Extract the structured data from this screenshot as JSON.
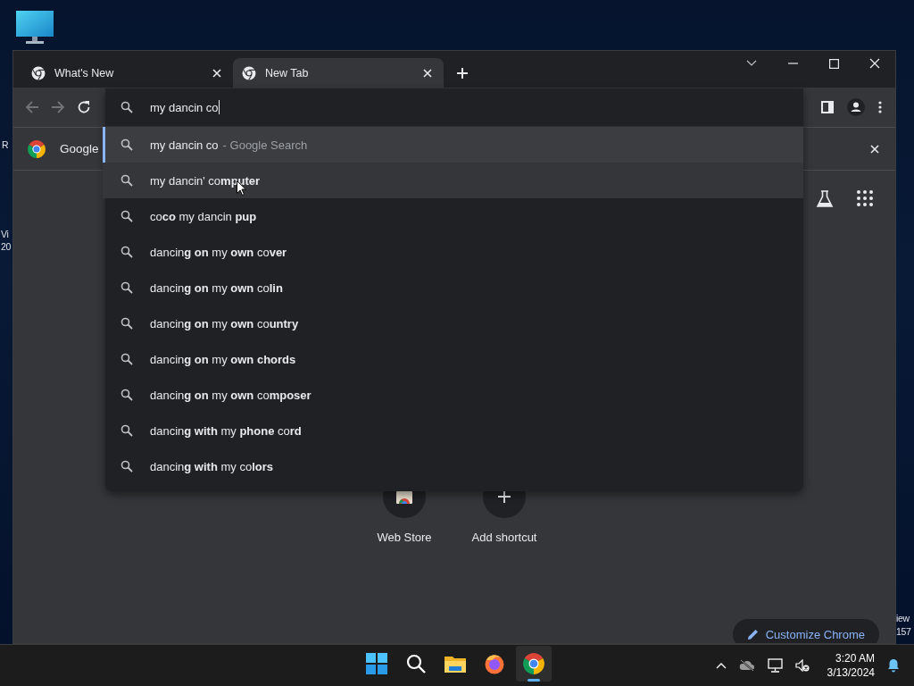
{
  "desktop": {
    "background_texts": [
      "R",
      "Vi",
      "20",
      "iew",
      "157"
    ]
  },
  "browser": {
    "tabs": [
      {
        "title": "What's New",
        "selected": false
      },
      {
        "title": "New Tab",
        "selected": true
      }
    ],
    "omnibox": {
      "value": "my dancin co"
    },
    "suggestions": [
      {
        "text": "my dancin co",
        "description": "- Google Search",
        "selected": true,
        "hovered": false
      },
      {
        "text": "my dancin' co**mputer**",
        "selected": false,
        "hovered": true
      },
      {
        "text": "co**co** my dancin **pup**",
        "selected": false,
        "hovered": false
      },
      {
        "text": "dancin**g on** my **own** co**ver**",
        "selected": false,
        "hovered": false
      },
      {
        "text": "dancin**g on** my **own** co**lin**",
        "selected": false,
        "hovered": false
      },
      {
        "text": "dancin**g on** my **own** co**untry**",
        "selected": false,
        "hovered": false
      },
      {
        "text": "dancin**g on** my **own chords**",
        "selected": false,
        "hovered": false
      },
      {
        "text": "dancin**g on** my **own** co**mposer**",
        "selected": false,
        "hovered": false
      },
      {
        "text": "dancin**g with** my **phone** co**rd**",
        "selected": false,
        "hovered": false
      },
      {
        "text": "dancin**g with** my co**lors**",
        "selected": false,
        "hovered": false
      }
    ],
    "info_bar": {
      "text": "Google"
    },
    "shortcuts": [
      {
        "label": "Web Store",
        "kind": "store"
      },
      {
        "label": "Add shortcut",
        "kind": "add"
      }
    ],
    "customize_button": "Customize Chrome"
  },
  "taskbar": {
    "apps": [
      {
        "kind": "start",
        "active": false
      },
      {
        "kind": "search",
        "active": false
      },
      {
        "kind": "files",
        "active": false
      },
      {
        "kind": "firefox",
        "active": false
      },
      {
        "kind": "chrome",
        "active": true
      }
    ],
    "time": "3:20 AM",
    "date": "3/13/2024"
  }
}
